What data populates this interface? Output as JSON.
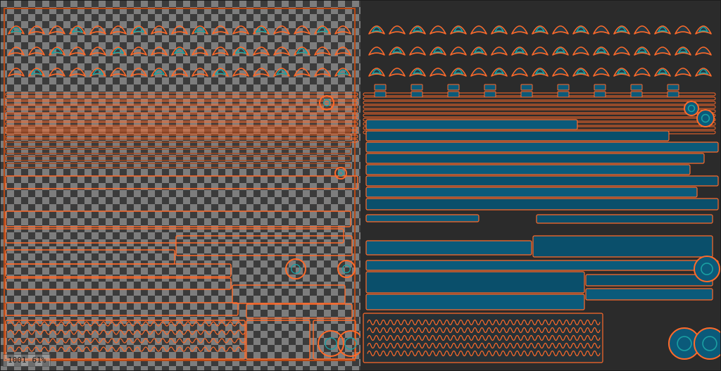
{
  "viewport": {
    "tile_label": "1001",
    "zoom_label": "61%"
  },
  "colors": {
    "background": "#2b2b2b",
    "uv_edge": "#ff6a2a",
    "uv_edge_dark": "#b84a16",
    "uv_fill": "#0b5a7a",
    "uv_fill_alt": "#0a4f6b",
    "teal": "#1aa0a3",
    "checker_light": "#7d7d7d",
    "checker_dark": "#3b3b3b"
  },
  "icons": {
    "tile": "tile-icon",
    "zoom": "zoom-icon"
  }
}
